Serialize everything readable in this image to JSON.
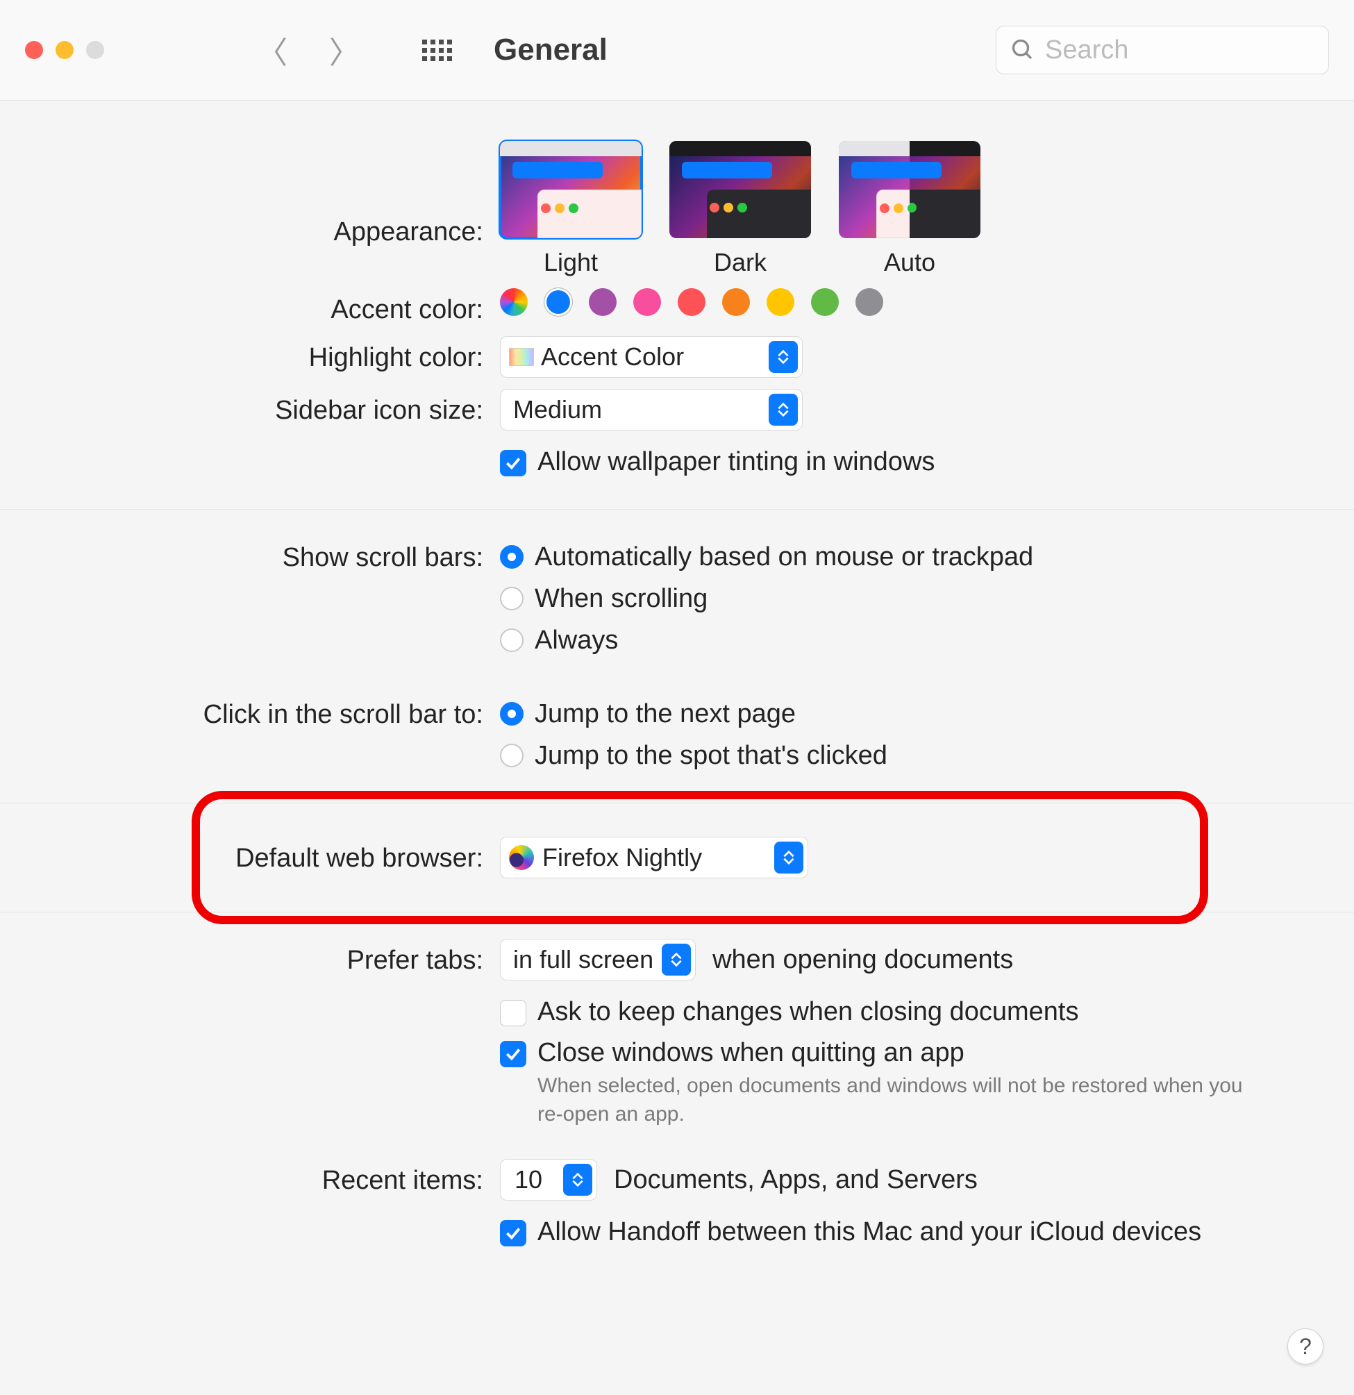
{
  "toolbar": {
    "title": "General",
    "search_placeholder": "Search"
  },
  "appearance": {
    "label": "Appearance:",
    "options": [
      {
        "id": "light",
        "caption": "Light",
        "selected": true
      },
      {
        "id": "dark",
        "caption": "Dark",
        "selected": false
      },
      {
        "id": "auto",
        "caption": "Auto",
        "selected": false
      }
    ]
  },
  "accent": {
    "label": "Accent color:",
    "colors": [
      "multi",
      "#0a7aff",
      "#a550a7",
      "#f74f9e",
      "#ff5257",
      "#f7821b",
      "#ffc600",
      "#62ba46",
      "#8e8e93"
    ],
    "selected_index": 1
  },
  "highlight": {
    "label": "Highlight color:",
    "value": "Accent Color"
  },
  "sidebar_size": {
    "label": "Sidebar icon size:",
    "value": "Medium"
  },
  "wallpaper_tint": {
    "label": "Allow wallpaper tinting in windows",
    "checked": true
  },
  "scroll_bars": {
    "label": "Show scroll bars:",
    "options": [
      {
        "label": "Automatically based on mouse or trackpad",
        "checked": true
      },
      {
        "label": "When scrolling",
        "checked": false
      },
      {
        "label": "Always",
        "checked": false
      }
    ]
  },
  "scroll_click": {
    "label": "Click in the scroll bar to:",
    "options": [
      {
        "label": "Jump to the next page",
        "checked": true
      },
      {
        "label": "Jump to the spot that's clicked",
        "checked": false
      }
    ]
  },
  "default_browser": {
    "label": "Default web browser:",
    "value": "Firefox Nightly"
  },
  "prefer_tabs": {
    "label": "Prefer tabs:",
    "value": "in full screen",
    "suffix": "when opening documents"
  },
  "ask_keep_changes": {
    "label": "Ask to keep changes when closing documents",
    "checked": false
  },
  "close_windows_quit": {
    "label": "Close windows when quitting an app",
    "checked": true,
    "explain": "When selected, open documents and windows will not be restored when you re-open an app."
  },
  "recent_items": {
    "label": "Recent items:",
    "value": "10",
    "suffix": "Documents, Apps, and Servers"
  },
  "handoff": {
    "label": "Allow Handoff between this Mac and your iCloud devices",
    "checked": true
  },
  "help": "?"
}
